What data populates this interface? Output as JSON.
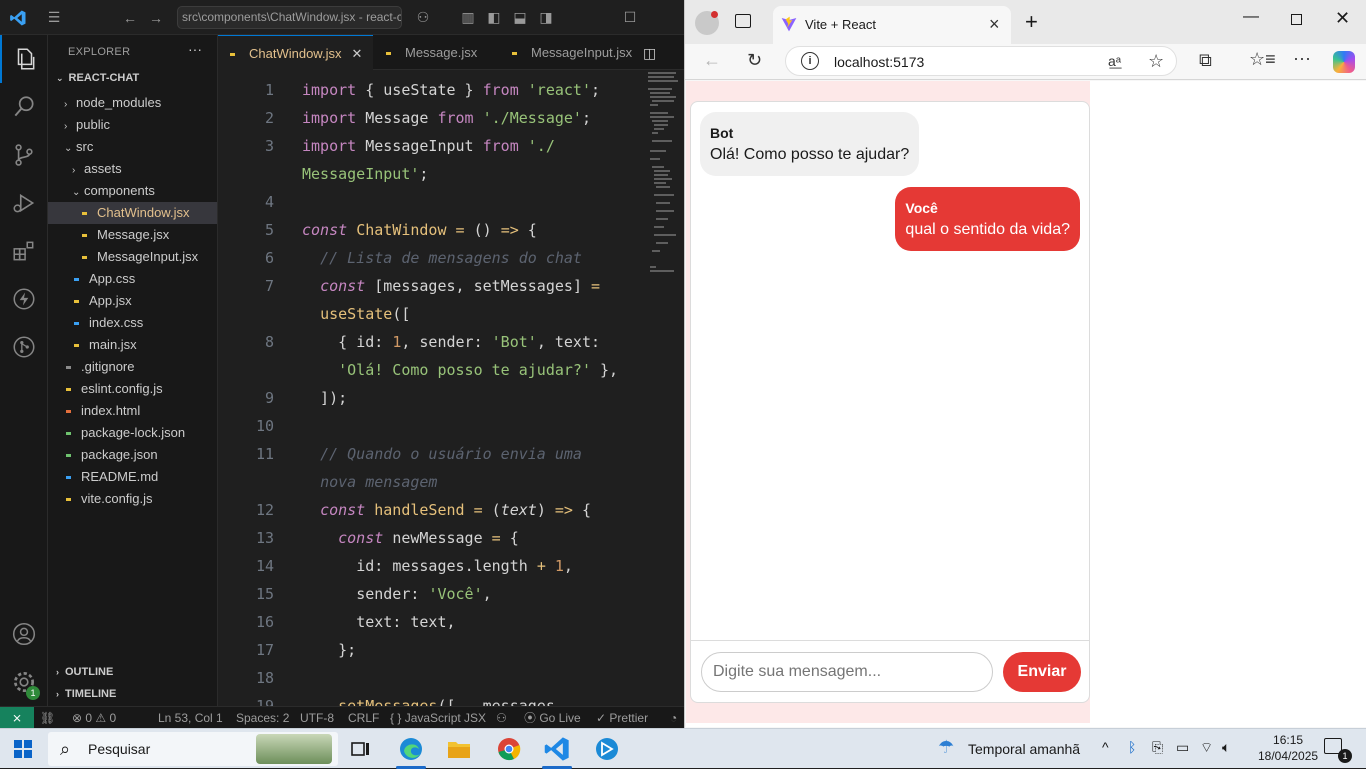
{
  "vscode": {
    "command_center": "src\\components\\ChatWindow.jsx - react-c",
    "explorer_title": "EXPLORER",
    "project": "REACT-CHAT",
    "tree": [
      {
        "label": "node_modules",
        "type": "folder",
        "depth": 0,
        "open": false,
        "color": "#cccccc"
      },
      {
        "label": "public",
        "type": "folder",
        "depth": 0,
        "open": false,
        "color": "#cccccc"
      },
      {
        "label": "src",
        "type": "folder",
        "depth": 0,
        "open": true,
        "color": "#cccccc"
      },
      {
        "label": "assets",
        "type": "folder",
        "depth": 1,
        "open": false,
        "color": "#cccccc"
      },
      {
        "label": "components",
        "type": "folder",
        "depth": 1,
        "open": true,
        "color": "#cccccc"
      },
      {
        "label": "ChatWindow.jsx",
        "type": "file",
        "depth": 2,
        "icon_color": "#e8c03a",
        "active": true
      },
      {
        "label": "Message.jsx",
        "type": "file",
        "depth": 2,
        "icon_color": "#e8c03a"
      },
      {
        "label": "MessageInput.jsx",
        "type": "file",
        "depth": 2,
        "icon_color": "#e8c03a"
      },
      {
        "label": "App.css",
        "type": "file",
        "depth": 1,
        "icon_color": "#3aa0f3"
      },
      {
        "label": "App.jsx",
        "type": "file",
        "depth": 1,
        "icon_color": "#e8c03a"
      },
      {
        "label": "index.css",
        "type": "file",
        "depth": 1,
        "icon_color": "#3aa0f3"
      },
      {
        "label": "main.jsx",
        "type": "file",
        "depth": 1,
        "icon_color": "#e8c03a"
      },
      {
        "label": ".gitignore",
        "type": "file",
        "depth": 0,
        "icon_color": "#8a8a8a"
      },
      {
        "label": "eslint.config.js",
        "type": "file",
        "depth": 0,
        "icon_color": "#e8c03a"
      },
      {
        "label": "index.html",
        "type": "file",
        "depth": 0,
        "icon_color": "#e36f3c"
      },
      {
        "label": "package-lock.json",
        "type": "file",
        "depth": 0,
        "icon_color": "#6fc36f"
      },
      {
        "label": "package.json",
        "type": "file",
        "depth": 0,
        "icon_color": "#6fc36f"
      },
      {
        "label": "README.md",
        "type": "file",
        "depth": 0,
        "icon_color": "#3aa0f3"
      },
      {
        "label": "vite.config.js",
        "type": "file",
        "depth": 0,
        "icon_color": "#e8c03a"
      }
    ],
    "outline": "OUTLINE",
    "timeline": "TIMELINE",
    "tabs": [
      "ChatWindow.jsx",
      "Message.jsx",
      "MessageInput.jsx"
    ],
    "code_lines": [
      {
        "n": "1",
        "html": "<span class='kw'>import</span> { <span class='pr'>useState</span> } <span class='kw'>from</span> <span class='str'>'react'</span>;"
      },
      {
        "n": "2",
        "html": "<span class='kw'>import</span> <span class='pr'>Message</span> <span class='kw'>from</span> <span class='str'>'./Message'</span>;"
      },
      {
        "n": "3",
        "html": "<span class='kw'>import</span> <span class='pr'>MessageInput</span> <span class='kw'>from</span> <span class='str'>'./</span>"
      },
      {
        "n": "",
        "html": "<span class='str'>MessageInput'</span>;"
      },
      {
        "n": "4",
        "html": ""
      },
      {
        "n": "5",
        "html": "<span class='kw2'>const</span> <span class='fn'>ChatWindow</span> <span class='op'>=</span> () <span class='op'>=&gt;</span> {"
      },
      {
        "n": "6",
        "html": "  <span class='cm'>// Lista de mensagens do chat</span>"
      },
      {
        "n": "7",
        "html": "  <span class='kw2'>const</span> [<span class='pr'>messages</span>, <span class='pr'>setMessages</span>] <span class='op'>=</span>"
      },
      {
        "n": "",
        "html": "  <span class='fn'>useState</span>(["
      },
      {
        "n": "8",
        "html": "    { <span class='pr'>id</span>: <span class='num'>1</span>, <span class='pr'>sender</span>: <span class='str'>'Bot'</span>, <span class='pr'>text</span>:"
      },
      {
        "n": "",
        "html": "    <span class='str'>'Olá! Como posso te ajudar?'</span> },"
      },
      {
        "n": "9",
        "html": "  ]);"
      },
      {
        "n": "10",
        "html": ""
      },
      {
        "n": "11",
        "html": "  <span class='cm'>// Quando o usuário envia uma</span>"
      },
      {
        "n": "",
        "html": "  <span class='cm'>nova mensagem</span>"
      },
      {
        "n": "12",
        "html": "  <span class='kw2'>const</span> <span class='fn'>handleSend</span> <span class='op'>=</span> (<span class='pr' style='font-style:italic'>text</span>) <span class='op'>=&gt;</span> {"
      },
      {
        "n": "13",
        "html": "    <span class='kw2'>const</span> <span class='pr'>newMessage</span> <span class='op'>=</span> {"
      },
      {
        "n": "14",
        "html": "      <span class='pr'>id</span>: <span class='pr'>messages</span>.<span class='pr'>length</span> <span class='op'>+</span> <span class='num'>1</span>,"
      },
      {
        "n": "15",
        "html": "      <span class='pr'>sender</span>: <span class='str'>'Você'</span>,"
      },
      {
        "n": "16",
        "html": "      <span class='pr'>text</span>: <span class='pr'>text</span>,"
      },
      {
        "n": "17",
        "html": "    };"
      },
      {
        "n": "18",
        "html": ""
      },
      {
        "n": "19",
        "html": "    <span class='fn'>setMessages</span>([<span class='op'>...</span><span class='pr'>messages</span>,"
      }
    ],
    "status": {
      "errors": "0",
      "warnings": "0",
      "position": "Ln 53, Col 1",
      "spaces": "Spaces: 2",
      "encoding": "UTF-8",
      "eol": "CRLF",
      "language": "JavaScript JSX",
      "golive": "Go Live",
      "prettier": "Prettier"
    },
    "notification_count": "1"
  },
  "browser": {
    "tab_title": "Vite + React",
    "url": "localhost:5173",
    "chat": {
      "messages": [
        {
          "sender": "Bot",
          "text": "Olá! Como posso te ajudar?"
        },
        {
          "sender": "Você",
          "text": "qual o sentido da vida?"
        }
      ],
      "input_placeholder": "Digite sua mensagem...",
      "send_label": "Enviar",
      "user_color": "#e53935",
      "bot_color": "#f0f0f0"
    }
  },
  "taskbar": {
    "search_placeholder": "Pesquisar",
    "weather": "Temporal amanhã",
    "time": "16:15",
    "date": "18/04/2025",
    "notifications": "1"
  }
}
